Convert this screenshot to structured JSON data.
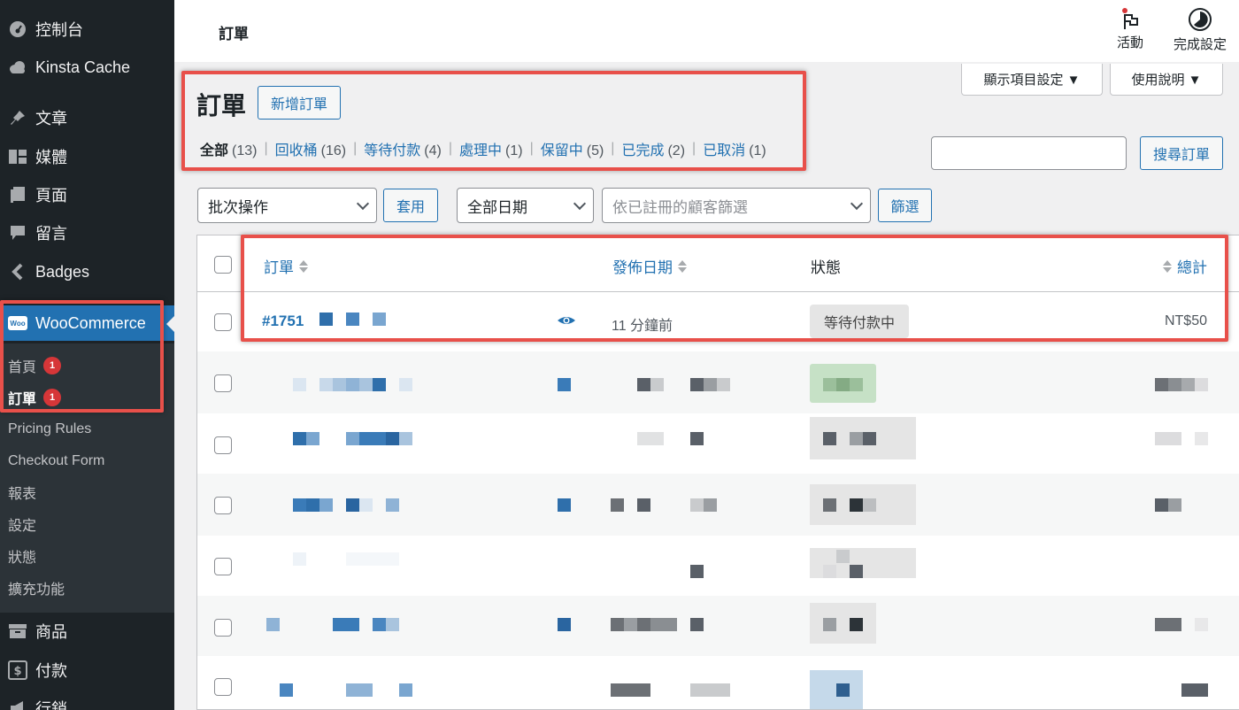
{
  "sidebar": {
    "items": [
      {
        "label": "控制台",
        "icon": "dashboard-icon"
      },
      {
        "label": "Kinsta Cache",
        "icon": "cloud-icon"
      },
      {
        "label": "文章",
        "icon": "pin-icon"
      },
      {
        "label": "媒體",
        "icon": "media-icon"
      },
      {
        "label": "頁面",
        "icon": "page-icon"
      },
      {
        "label": "留言",
        "icon": "comment-icon"
      },
      {
        "label": "Badges",
        "icon": "chevron-left-icon"
      },
      {
        "label": "WooCommerce",
        "icon": "woo-icon",
        "logo_text": "Woo"
      },
      {
        "label": "商品",
        "icon": "archive-icon"
      },
      {
        "label": "付款",
        "icon": "dollar-icon"
      },
      {
        "label": "行銷",
        "icon": "megaphone-icon"
      }
    ],
    "woo_submenu": [
      {
        "label": "首頁",
        "badge": "1"
      },
      {
        "label": "訂單",
        "badge": "1"
      },
      {
        "label": "Pricing Rules"
      },
      {
        "label": "Checkout Form"
      },
      {
        "label": "報表"
      },
      {
        "label": "設定"
      },
      {
        "label": "狀態"
      },
      {
        "label": "擴充功能"
      }
    ]
  },
  "header": {
    "title": "訂單",
    "activity_label": "活動",
    "setup_label": "完成設定"
  },
  "screen_options_label": "顯示項目設定 ▼",
  "help_label": "使用說明 ▼",
  "page": {
    "heading": "訂單",
    "add_new_label": "新增訂單"
  },
  "status_filters": [
    {
      "label": "全部",
      "count": "(13)"
    },
    {
      "label": "回收桶",
      "count": "(16)"
    },
    {
      "label": "等待付款",
      "count": "(4)"
    },
    {
      "label": "處理中",
      "count": "(1)"
    },
    {
      "label": "保留中",
      "count": "(5)"
    },
    {
      "label": "已完成",
      "count": "(2)"
    },
    {
      "label": "已取消",
      "count": "(1)"
    }
  ],
  "search": {
    "value": "",
    "button_label": "搜尋訂單"
  },
  "filters": {
    "bulk_action": "批次操作",
    "apply_label": "套用",
    "date_filter": "全部日期",
    "customer_placeholder": "依已註冊的顧客篩選",
    "filter_label": "篩選"
  },
  "table": {
    "headers": {
      "order": "訂單",
      "date": "發佈日期",
      "status": "狀態",
      "total": "總計"
    },
    "first_row": {
      "order": "#1751",
      "date": "11 分鐘前",
      "status": "等待付款中",
      "total": "NT$50"
    }
  }
}
